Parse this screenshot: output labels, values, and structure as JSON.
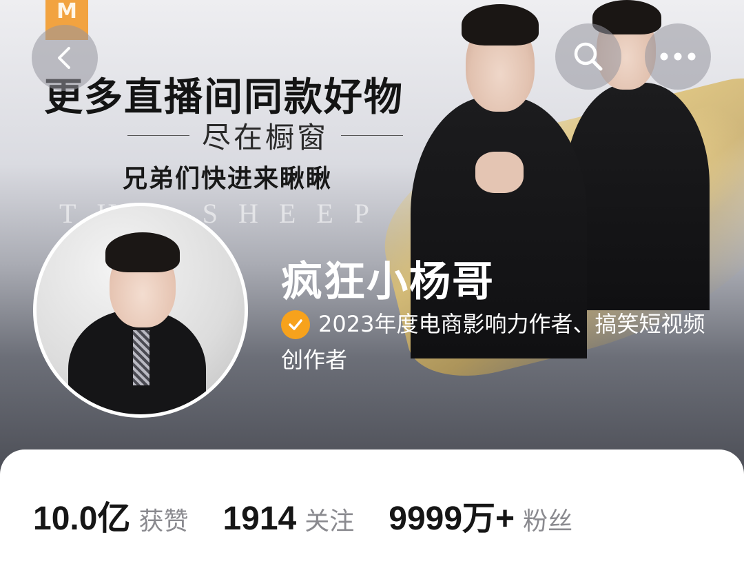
{
  "header": {
    "promo_title": "更多直播间同款好物",
    "promo_subtitle": "尽在橱窗",
    "promo_tagline": "兄弟们快进来瞅瞅",
    "watermark": "THE SHEEP"
  },
  "nav": {
    "back_icon": "chevron-left-icon",
    "search_icon": "search-icon",
    "more_icon": "more-horizontal-icon"
  },
  "profile": {
    "name": "疯狂小杨哥",
    "verification": "2023年度电商影响力作者、搞笑短视频创作者",
    "badge_color": "#f7a21c"
  },
  "stats": [
    {
      "value": "10.0亿",
      "label": "获赞"
    },
    {
      "value": "1914",
      "label": "关注"
    },
    {
      "value": "9999万+",
      "label": "粉丝"
    }
  ]
}
